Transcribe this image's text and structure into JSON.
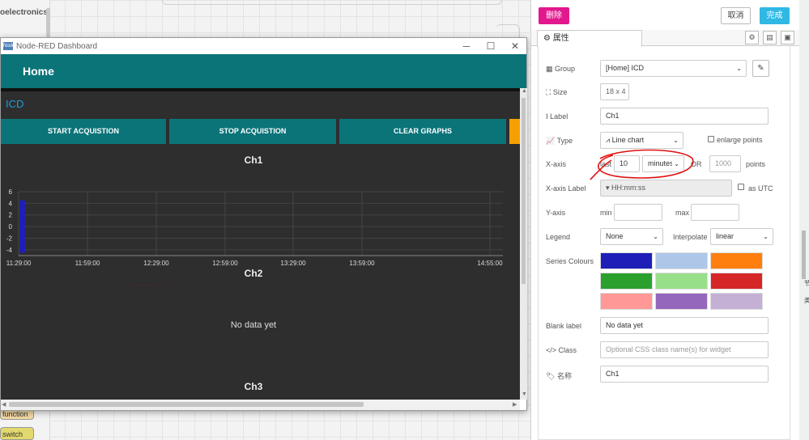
{
  "palette": {
    "category": "oelectronics",
    "nodes": [
      {
        "label": "function",
        "color": "#f3d9a4"
      },
      {
        "label": "switch",
        "color": "#e2d96e"
      }
    ]
  },
  "window": {
    "title": "Node-RED Dashboard",
    "logo_text": "Node",
    "controls": {
      "minimize": "─",
      "maximize": "☐",
      "close": "✕"
    }
  },
  "dashboard": {
    "header": "Home",
    "group": "ICD",
    "buttons": [
      "START ACQUISTION",
      "STOP ACQUISTION",
      "CLEAR GRAPHS"
    ],
    "charts": [
      {
        "title": "Ch1"
      },
      {
        "title": "Ch2",
        "empty_text": "No data yet"
      },
      {
        "title": "Ch3"
      }
    ]
  },
  "chart_data": {
    "type": "bar",
    "title": "Ch1",
    "x_ticks": [
      "11:29:00",
      "11:59:00",
      "12:29:00",
      "12:59:00",
      "13:29:00",
      "13:59:00",
      "14:55:00"
    ],
    "y_ticks": [
      6,
      4,
      2,
      0,
      -2,
      -4
    ],
    "ylim": [
      -5,
      6
    ],
    "series_color": "#1f1fb8",
    "bars": [
      {
        "x": "11:29:00",
        "y": 4.5,
        "base": -4.5
      }
    ],
    "grid": true
  },
  "panel": {
    "delete_label": "删除",
    "cancel_label": "取消",
    "done_label": "完成",
    "tab_label": "属性",
    "fields": {
      "group": {
        "label": "Group",
        "value": "[Home] ICD"
      },
      "size": {
        "label": "Size",
        "value": "18 x 4"
      },
      "label": {
        "label": "Label",
        "value": "Ch1"
      },
      "type": {
        "label": "Type",
        "value": "Line chart",
        "enlarge_label": "enlarge points"
      },
      "xaxis": {
        "label": "X-axis",
        "last": "last",
        "value": "10",
        "unit": "minutes",
        "or": "OR",
        "points_placeholder": "1000",
        "points": "points"
      },
      "xaxis_label": {
        "label": "X-axis Label",
        "value": "HH:mm:ss",
        "utc_label": "as UTC"
      },
      "yaxis": {
        "label": "Y-axis",
        "min": "min",
        "max": "max"
      },
      "legend": {
        "label": "Legend",
        "value": "None",
        "interpolate_label": "Interpolate",
        "interpolate_value": "linear"
      },
      "series": {
        "label": "Series Colours",
        "colors": [
          "#1f1fb8",
          "#aec7e8",
          "#ff7f0e",
          "#2ca02c",
          "#98df8a",
          "#d62728",
          "#ff9896",
          "#9467bd",
          "#c5b0d5"
        ]
      },
      "blank": {
        "label": "Blank label",
        "value": "No data yet"
      },
      "class": {
        "label": "Class",
        "placeholder": "Optional CSS class name(s) for widget"
      },
      "name": {
        "label": "名称",
        "value": "Ch1"
      }
    },
    "side_chars": [
      "节",
      "类"
    ]
  },
  "annotation_color": "#e01010"
}
